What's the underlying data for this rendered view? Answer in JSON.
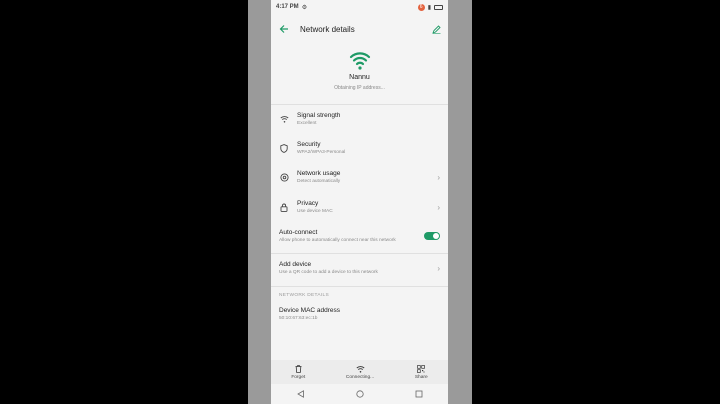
{
  "status_bar": {
    "time": "4:17 PM",
    "badge": "6"
  },
  "app_bar": {
    "title": "Network details"
  },
  "network": {
    "name": "Nannu",
    "status": "Obtaining IP address..."
  },
  "rows": [
    {
      "label": "Signal strength",
      "sub": "Excellent",
      "icon": "wifi-icon"
    },
    {
      "label": "Security",
      "sub": "WPA2/WPA3-Personal",
      "icon": "shield-icon"
    },
    {
      "label": "Network usage",
      "sub": "Detect automatically",
      "icon": "data-usage-icon"
    },
    {
      "label": "Privacy",
      "sub": "Use device MAC",
      "icon": "lock-icon"
    }
  ],
  "auto_connect": {
    "label": "Auto-connect",
    "sub": "Allow phone to automatically connect near this network",
    "enabled": true
  },
  "add_device": {
    "label": "Add device",
    "sub": "Use a QR code to add a device to this network"
  },
  "section": {
    "header": "NETWORK DETAILS"
  },
  "mac": {
    "label": "Device MAC address",
    "value": "50:10:67:63:ec:1b"
  },
  "bottom_actions": {
    "forget": "Forget",
    "connecting": "Connecting...",
    "share": "Share"
  },
  "colors": {
    "accent": "#1e9a66"
  }
}
